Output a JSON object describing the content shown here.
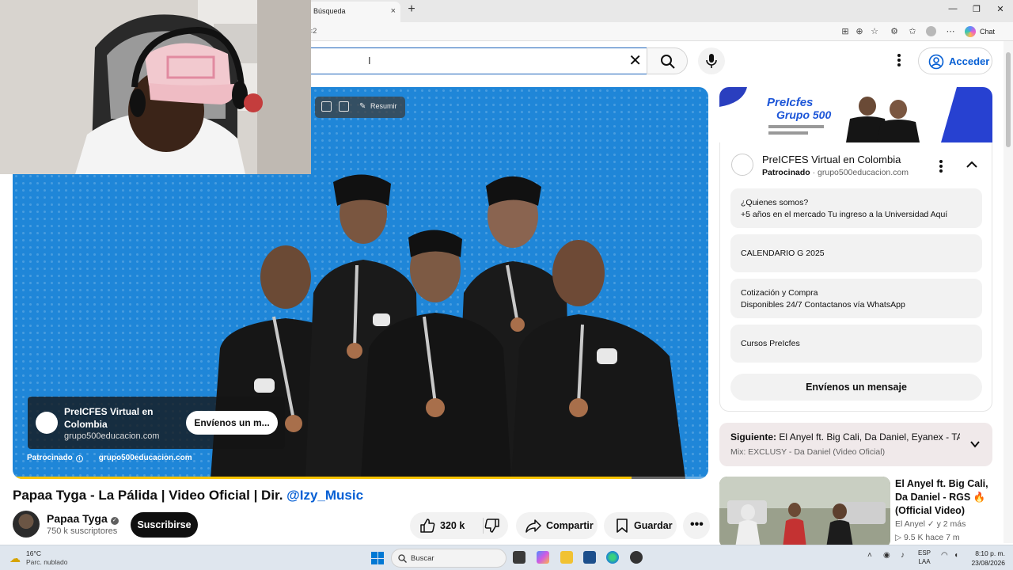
{
  "browser": {
    "tab_title": "Búsqueda",
    "tab_close": "×",
    "new_tab": "+",
    "url_fragment": "=2",
    "chat_label": "Chat",
    "window_controls": [
      "—",
      "❐",
      "✕"
    ]
  },
  "header": {
    "search_value": "",
    "search_clear": "✕",
    "signin_label": "Acceder"
  },
  "player": {
    "summarize_label": "Resumir",
    "ad_overlay": {
      "title": "PreICFES Virtual en Colombia",
      "domain": "grupo500educacion.com",
      "cta": "Envíenos un m..."
    },
    "sponsored_label": "Patrocinado",
    "sponsored_domain": "grupo500educacion.com",
    "progress_fraction": 0.89,
    "progress_color": "#f7c400"
  },
  "video": {
    "title": "Papaa Tyga - La Pálida | Video Oficial | Dir. ",
    "title_link": "@Izy_Music",
    "channel": "Papaa Tyga",
    "subscribers": "750 k suscriptores",
    "subscribe": "Suscribirse",
    "likes": "320 k",
    "share": "Compartir",
    "save": "Guardar"
  },
  "sidebar_ad": {
    "banner_brand_line1": "PreIcfes",
    "banner_brand_line2": "Grupo 500",
    "title": "PreICFES Virtual en Colombia",
    "sponsored": "Patrocinado",
    "domain": "· grupo500educacion.com",
    "items": [
      {
        "line1": "¿Quienes somos?",
        "line2": "+5 años en el mercado Tu ingreso a la Universidad Aquí"
      },
      {
        "line1": "CALENDARIO G 2025",
        "line2": ""
      },
      {
        "line1": "Cotización y Compra",
        "line2": "Disponibles 24/7 Contactanos vía WhatsApp"
      },
      {
        "line1": "Cursos PreIcfes",
        "line2": ""
      }
    ],
    "cta": "Envíenos un mensaje"
  },
  "up_next": {
    "label": "Siguiente:",
    "title": " El Anyel ft. Big Cali, Da Daniel, Eyanex - TA...",
    "mix": "Mix: EXCLUSY - Da Daniel (Video Oficial)"
  },
  "recommendation": {
    "title": "El Anyel ft. Big Cali, Da Daniel - RGS 🔥 (Official Video)",
    "channel": "El Anyel ✓ y 2 más",
    "stats": "▷ 9.5 K   hace 7 m"
  },
  "taskbar": {
    "temp": "16°C",
    "condition": "Parc. nublado",
    "search_label": "Buscar",
    "lang_1": "ESP",
    "lang_2": "LAA",
    "time": "8:10 p. m.",
    "date": "23/08/2026"
  }
}
